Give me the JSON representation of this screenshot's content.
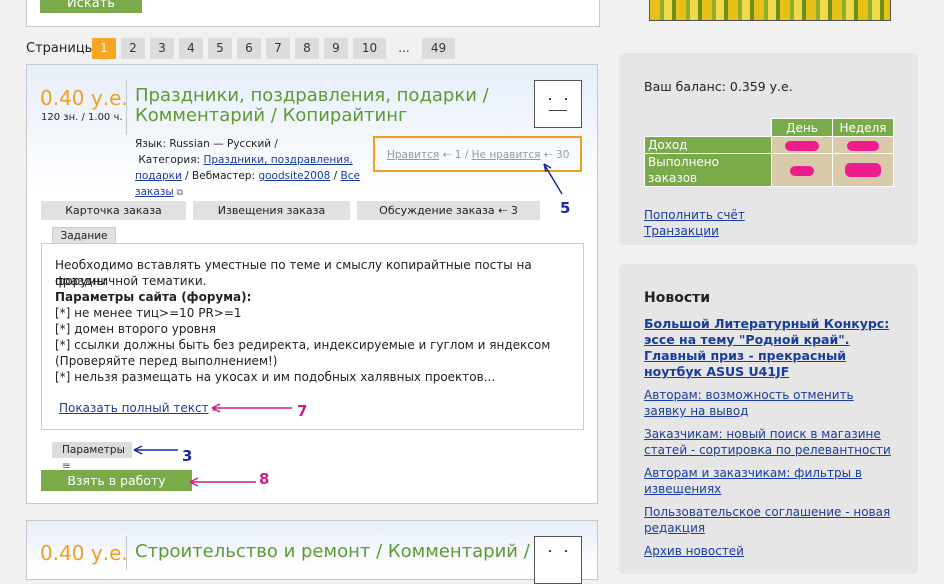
{
  "search": {
    "button_label": "Искать"
  },
  "pagination": {
    "label": "Страницы:",
    "pages": [
      "1",
      "2",
      "3",
      "4",
      "5",
      "6",
      "7",
      "8",
      "9",
      "10",
      "...",
      "49"
    ],
    "current": "1"
  },
  "order": {
    "price": "0.40 у.е.",
    "price_detail": "120 зн. / 1.00 ч.",
    "title": "Праздники, поздравления, подарки / Комментарий / Копирайтинг",
    "language_label": "Язык:",
    "language_value": "Russian — Русский /",
    "category_label": "Категория:",
    "category_link": "Праздники, поздравления, подарки",
    "webmaster_label": "/ Вебмастер:",
    "webmaster_link": "goodsite2008",
    "all_orders_link": "Все заказы",
    "like_link": "Нравится",
    "like_count": "1",
    "dislike_link": "Не нравится",
    "dislike_count": "30",
    "tabs": [
      "Карточка заказа",
      "Извещения заказа",
      "Обсуждение заказа"
    ],
    "discussion_count": "3",
    "task_tab": "Задание",
    "task_text": {
      "line1": "Необходимо вставлять уместные по теме и смыслу копирайтные посты на форумы",
      "line2": "праздничной тематики.",
      "line3": "Параметры сайта (форума):",
      "line4": "[*] не менее тиц>=10 PR>=1",
      "line5": "[*] домен второго уровня",
      "line6": "[*] ссылки должны быть без редиректа, индексируемые и гуглом и яндексом",
      "line7": "(Проверяйте перед выполнением!)",
      "line8": "[*] нельзя размещать на укосах и им подобных халявных проектов..."
    },
    "show_full": "Показать полный текст",
    "params_label": "Параметры",
    "take_button": "Взять в работу"
  },
  "annotations": {
    "a5": "5",
    "a7": "7",
    "a3": "3",
    "a8": "8"
  },
  "order2": {
    "price": "0.40 у.е.",
    "title": "Строительство и ремонт / Комментарий /"
  },
  "balance": {
    "text": "Ваш баланс: 0.359 у.е.",
    "col_day": "День",
    "col_week": "Неделя",
    "row_income": "Доход",
    "row_done": "Выполнено заказов",
    "topup_link": "Пополнить счёт",
    "transactions_link": "Транзакции"
  },
  "news": {
    "heading": "Новости",
    "items": [
      "Большой Литературный Конкурс: эссе на тему \"Родной край\". Главный приз - прекрасный ноутбук ASUS U41JF",
      "Авторам: возможность отменить заявку на вывод",
      "Заказчикам: новый поиск в магазине статей - сортировка по релевантности",
      "Авторам и заказчикам: фильтры в извещениях",
      "Пользовательское соглашение - новая редакция",
      "Архив новостей"
    ]
  },
  "colors": {
    "accent_green": "#7aab4a",
    "price_orange": "#f0a020",
    "title_green": "#5e9a32",
    "annotation_pink": "#cc1f85",
    "annotation_blue": "#1b2a9a"
  }
}
